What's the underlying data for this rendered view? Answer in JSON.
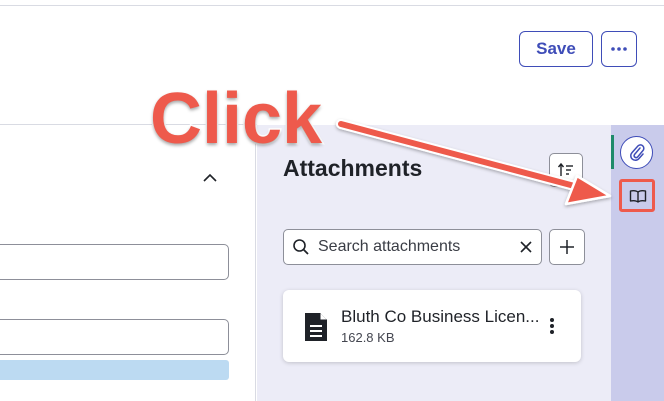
{
  "header": {
    "save_label": "Save",
    "more_icon": "ellipsis-icon"
  },
  "form": {
    "collapse_icon": "chevron-up-icon",
    "progress_fraction": 1.0
  },
  "attachments": {
    "title": "Attachments",
    "sort_icon": "sort-icon",
    "search": {
      "placeholder": "Search attachments",
      "value": "",
      "search_icon": "search-icon",
      "clear_icon": "close-icon"
    },
    "add_icon": "plus-icon",
    "files": [
      {
        "name": "Bluth Co Business Licen...",
        "size": "162.8 KB",
        "icon": "document-icon",
        "menu_icon": "kebab-icon"
      }
    ]
  },
  "rail": {
    "items": [
      {
        "icon": "paperclip-icon",
        "active": true
      },
      {
        "icon": "book-icon",
        "active": false
      }
    ]
  },
  "annotation": {
    "label": "Click",
    "color": "#ee5a4c"
  },
  "colors": {
    "accent": "#3f4db8",
    "panel_bg": "#ececf7",
    "rail_bg": "#c9cbeb",
    "active_indicator": "#1e8a6a",
    "annotation": "#ee5a4c"
  }
}
